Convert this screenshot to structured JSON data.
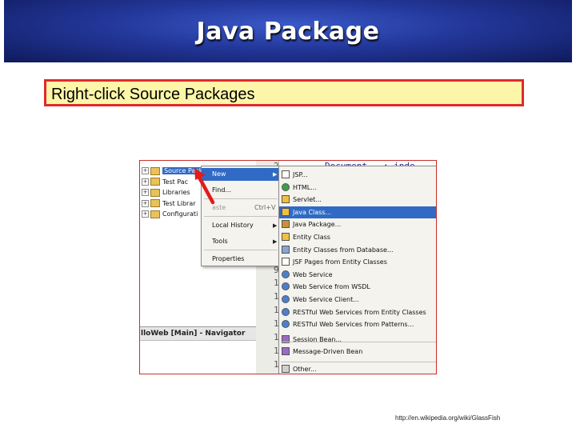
{
  "slide": {
    "title": "Java Package",
    "instruction": "Right-click Source Packages",
    "source_url": "http://en.wikipedia.org/wiki/GlassFish"
  },
  "colors": {
    "banner_blue": "#23379a",
    "callout_fill": "#fdf6a8",
    "callout_border": "#e22a2a",
    "arrow_red": "#e21b1b",
    "selection_blue": "#316ac5"
  },
  "ide": {
    "project_tree": [
      {
        "label": "Source Packa",
        "expander": "+",
        "icon": "folder-icon",
        "selected": true
      },
      {
        "label": "Test Pac",
        "expander": "+",
        "icon": "folder-icon",
        "selected": false
      },
      {
        "label": "Libraries",
        "expander": "+",
        "icon": "folder-icon",
        "selected": false
      },
      {
        "label": "Test Librar",
        "expander": "+",
        "icon": "folder-icon",
        "selected": false
      },
      {
        "label": "Configurati",
        "expander": "+",
        "icon": "folder-icon",
        "selected": false
      }
    ],
    "navigator_title": "lloWeb [Main] - Navigator",
    "editor": {
      "top_line": "Document   : inde",
      "line_numbers": [
        "2",
        "",
        "",
        "",
        "",
        "",
        "",
        "",
        "9",
        "10",
        "11",
        "12",
        "13",
        "14",
        "15",
        "16"
      ]
    },
    "context_menu": [
      {
        "label": "New",
        "shortcut": "",
        "submenu": true,
        "highlighted": true,
        "disabled": false
      },
      {
        "label": "Find...",
        "shortcut": "",
        "submenu": false,
        "highlighted": false,
        "disabled": false
      },
      {
        "label": "aste",
        "shortcut": "Ctrl+V",
        "submenu": false,
        "highlighted": false,
        "disabled": true
      },
      {
        "label": "Local History",
        "shortcut": "",
        "submenu": true,
        "highlighted": false,
        "disabled": false
      },
      {
        "label": "Tools",
        "shortcut": "",
        "submenu": true,
        "highlighted": false,
        "disabled": false
      },
      {
        "label": "Properties",
        "shortcut": "",
        "submenu": false,
        "highlighted": false,
        "disabled": false
      }
    ],
    "new_submenu": [
      {
        "label": "JSP...",
        "icon": "jsp-file-icon",
        "highlighted": false
      },
      {
        "label": "HTML...",
        "icon": "html-file-icon",
        "highlighted": false
      },
      {
        "label": "Servlet...",
        "icon": "servlet-icon",
        "highlighted": false
      },
      {
        "label": "Java Class...",
        "icon": "java-class-icon",
        "highlighted": true
      },
      {
        "label": "Java Package...",
        "icon": "java-package-icon",
        "highlighted": false
      },
      {
        "label": "Entity Class",
        "icon": "entity-class-icon",
        "highlighted": false
      },
      {
        "label": "Entity Classes from Database...",
        "icon": "database-icon",
        "highlighted": false
      },
      {
        "label": "JSF Pages from Entity Classes",
        "icon": "jsf-pages-icon",
        "highlighted": false
      },
      {
        "label": "Web Service",
        "icon": "web-service-icon",
        "highlighted": false
      },
      {
        "label": "Web Service from WSDL",
        "icon": "wsdl-icon",
        "highlighted": false
      },
      {
        "label": "Web Service Client...",
        "icon": "web-service-client-icon",
        "highlighted": false
      },
      {
        "label": "RESTful Web Services from Entity Classes",
        "icon": "restful-entity-icon",
        "highlighted": false
      },
      {
        "label": "RESTful Web Services from Patterns...",
        "icon": "restful-patterns-icon",
        "highlighted": false
      },
      {
        "label": "Session Bean...",
        "icon": "session-bean-icon",
        "highlighted": false
      },
      {
        "label": "Message-Driven Bean",
        "icon": "message-bean-icon",
        "highlighted": false
      },
      {
        "label": "Other...",
        "icon": "other-file-icon",
        "highlighted": false
      }
    ]
  }
}
